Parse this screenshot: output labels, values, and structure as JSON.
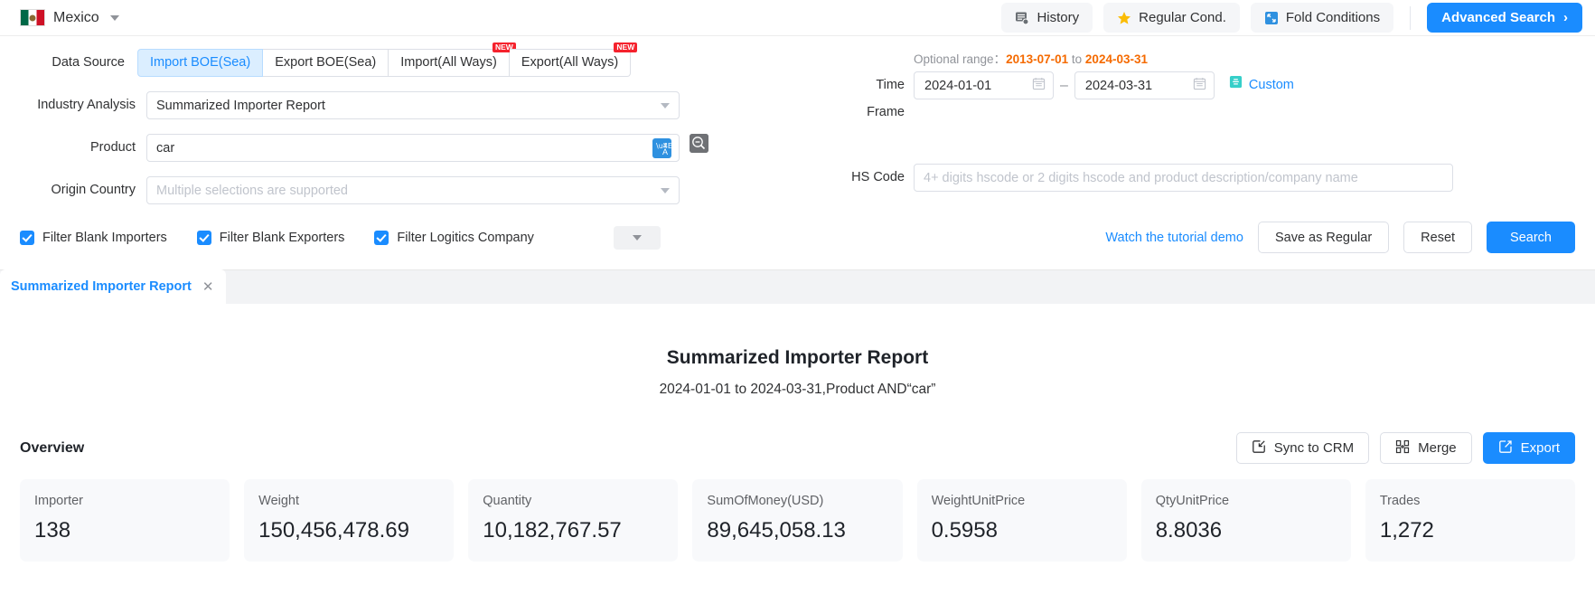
{
  "topbar": {
    "country": "Mexico",
    "actions": [
      {
        "label": "History",
        "icon": "history-icon"
      },
      {
        "label": "Regular Cond.",
        "icon": "star-icon"
      },
      {
        "label": "Fold Conditions",
        "icon": "fold-icon"
      }
    ],
    "advanced_search": "Advanced Search",
    "advanced_search_chevron": "›"
  },
  "search": {
    "data_source_label": "Data Source",
    "tabs": [
      {
        "label": "Import BOE(Sea)",
        "active": true,
        "badge": ""
      },
      {
        "label": "Export BOE(Sea)",
        "active": false,
        "badge": ""
      },
      {
        "label": "Import(All Ways)",
        "active": false,
        "badge": "NEW"
      },
      {
        "label": "Export(All Ways)",
        "active": false,
        "badge": "NEW"
      }
    ],
    "industry_label": "Industry Analysis",
    "industry_value": "Summarized Importer Report",
    "product_label": "Product",
    "product_value": "car",
    "translate_icon": "translate-icon",
    "magnifier_icon": "magnifier-minus-icon",
    "origin_label": "Origin Country",
    "origin_placeholder": "Multiple selections are supported",
    "time_frame_label": "Time Frame",
    "optional_range_label": "Optional range：",
    "optional_range_start": "2013-07-01",
    "optional_range_to": "to",
    "optional_range_end": "2024-03-31",
    "date_start": "2024-01-01",
    "date_end": "2024-03-31",
    "date_separator": "–",
    "custom_label": "Custom",
    "hs_code_label": "HS Code",
    "hs_code_placeholder": "4+ digits hscode or 2 digits hscode and product description/company name",
    "filters": [
      {
        "label": "Filter Blank Importers",
        "checked": true
      },
      {
        "label": "Filter Blank Exporters",
        "checked": true
      },
      {
        "label": "Filter Logitics Company",
        "checked": true
      }
    ],
    "tutorial_link": "Watch the tutorial demo",
    "save_as_regular": "Save as Regular",
    "reset": "Reset",
    "search": "Search"
  },
  "result_tab": {
    "label": "Summarized Importer Report",
    "close": "✕"
  },
  "report": {
    "title": "Summarized Importer Report",
    "subtitle": "2024-01-01 to 2024-03-31,Product AND“car”",
    "overview_label": "Overview",
    "actions": [
      {
        "label": "Sync to CRM",
        "icon": "sync-icon",
        "style": "ghost"
      },
      {
        "label": "Merge",
        "icon": "merge-icon",
        "style": "ghost"
      },
      {
        "label": "Export",
        "icon": "export-icon",
        "style": "blue"
      }
    ],
    "cards": [
      {
        "label": "Importer",
        "value": "138"
      },
      {
        "label": "Weight",
        "value": "150,456,478.69"
      },
      {
        "label": "Quantity",
        "value": "10,182,767.57"
      },
      {
        "label": "SumOfMoney(USD)",
        "value": "89,645,058.13"
      },
      {
        "label": "WeightUnitPrice",
        "value": "0.5958"
      },
      {
        "label": "QtyUnitPrice",
        "value": "8.8036"
      },
      {
        "label": "Trades",
        "value": "1,272"
      }
    ]
  },
  "colors": {
    "accent": "#1a8cff",
    "orange": "#f56a00",
    "badge_red": "#f5222d",
    "tab_active_bg": "#dbeeff"
  }
}
